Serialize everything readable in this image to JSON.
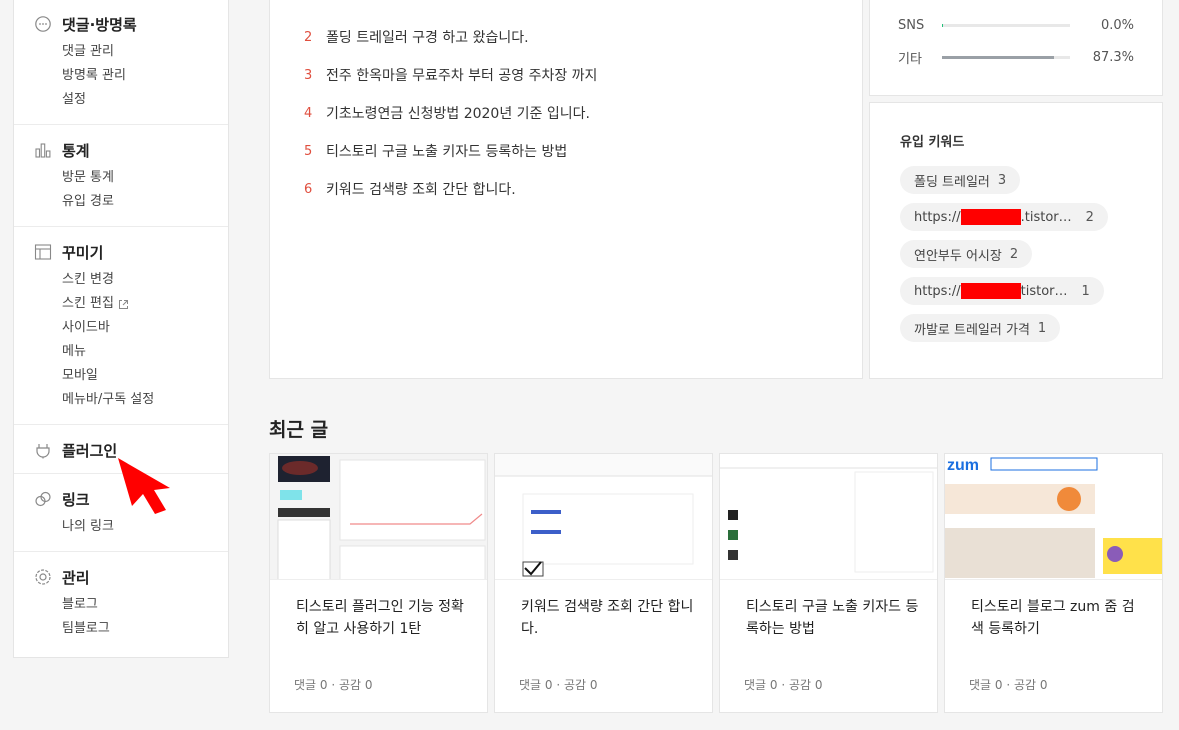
{
  "sidebar": {
    "sections": [
      {
        "title": "댓글·방명록",
        "icon": "speech-bubble-icon",
        "items": [
          "댓글 관리",
          "방명록 관리",
          "설정"
        ]
      },
      {
        "title": "통계",
        "icon": "bar-chart-icon",
        "items": [
          "방문 통계",
          "유입 경로"
        ]
      },
      {
        "title": "꾸미기",
        "icon": "layout-icon",
        "items": [
          "스킨 변경",
          "스킨 편집",
          "사이드바",
          "메뉴",
          "모바일",
          "메뉴바/구독 설정"
        ]
      },
      {
        "title": "플러그인",
        "icon": "plug-icon",
        "items": []
      },
      {
        "title": "링크",
        "icon": "link-icon",
        "items": [
          "나의 링크"
        ]
      },
      {
        "title": "관리",
        "icon": "gear-icon",
        "items": [
          "블로그",
          "팀블로그"
        ]
      }
    ]
  },
  "popular": {
    "items": [
      {
        "rank": "2",
        "title": "폴딩 트레일러 구경 하고 왔습니다."
      },
      {
        "rank": "3",
        "title": "전주 한옥마을 무료주차 부터 공영 주차장 까지"
      },
      {
        "rank": "4",
        "title": "기초노령연금 신청방법 2020년 기준 입니다."
      },
      {
        "rank": "5",
        "title": "티스토리 구글 노출 키자드 등록하는 방법"
      },
      {
        "rank": "6",
        "title": "키워드 검색량 조회 간단 합니다."
      }
    ]
  },
  "stats": {
    "rows": [
      {
        "label": "SNS",
        "value": "0.0%",
        "fraction": 0.01,
        "color": "#23c17a"
      },
      {
        "label": "기타",
        "value": "87.3%",
        "fraction": 0.873,
        "color": "#9aa0a6"
      }
    ]
  },
  "keywords": {
    "title": "유입 키워드",
    "items": [
      {
        "prefix": "폴딩 트레일러",
        "suffix": "",
        "count": "3",
        "redacted": false
      },
      {
        "prefix": "https://",
        "suffix": ".tistor…",
        "count": "2",
        "redacted": true
      },
      {
        "prefix": "연안부두 어시장",
        "suffix": "",
        "count": "2",
        "redacted": false
      },
      {
        "prefix": "https://",
        "suffix": "tistor…",
        "count": "1",
        "redacted": true
      },
      {
        "prefix": "까발로 트레일러 가격",
        "suffix": "",
        "count": "1",
        "redacted": false
      }
    ]
  },
  "recent": {
    "title": "최근 글",
    "cards": [
      {
        "title": "티스토리 플러그인 기능 정확히 알고 사용하기 1탄",
        "meta": "댓글 0 · 공감 0"
      },
      {
        "title": "키워드 검색량 조회 간단 합니다.",
        "meta": "댓글 0 · 공감 0"
      },
      {
        "title": "티스토리 구글 노출 키자드 등록하는 방법",
        "meta": "댓글 0 · 공감 0"
      },
      {
        "title": "티스토리 블로그 zum 줌 검색 등록하기",
        "meta": "댓글 0 · 공감 0",
        "thumb_logo": "zum"
      }
    ]
  },
  "annotation": {
    "arrow_color": "#ff0000"
  }
}
